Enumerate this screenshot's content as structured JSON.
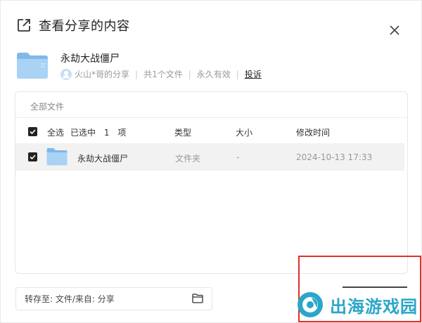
{
  "header": {
    "title": "查看分享的内容"
  },
  "share": {
    "name": "永劫大战僵尸",
    "owner": "火山*哥的分享",
    "file_count": "共1个文件",
    "validity": "永久有效",
    "report": "投诉"
  },
  "panel": {
    "breadcrumb": "全部文件",
    "columns": {
      "select_all": "全选",
      "selected_prefix": "已选中",
      "selected_count": "1",
      "selected_suffix": "项",
      "type": "类型",
      "size": "大小",
      "modified": "修改时间"
    },
    "rows": [
      {
        "name": "永劫大战僵尸",
        "type": "文件夹",
        "size": "-",
        "modified": "2024-10-13 17:33",
        "checked": true
      }
    ]
  },
  "save_to": {
    "label": "转存至: 文件/来自: 分享"
  },
  "watermark": {
    "text": "出海游戏园"
  },
  "colors": {
    "folder": "#7fb8ea",
    "highlight": "#e0302a",
    "watermark": "#2aa6c8"
  },
  "icons": {
    "header": "share-out-icon",
    "close": "close-icon",
    "folder": "folder-icon",
    "avatar": "user-avatar-icon",
    "checkbox": "checkbox-checked-icon"
  }
}
